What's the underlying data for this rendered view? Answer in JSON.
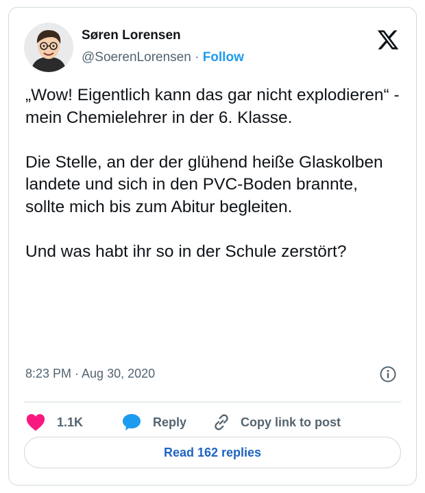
{
  "author": {
    "name": "Søren Lorensen",
    "handle": "@SoerenLorensen",
    "separator": "·",
    "follow_label": "Follow"
  },
  "tweet": {
    "text": "„Wow! Eigentlich kann das gar nicht explodieren“ - mein Chemielehrer in der 6. Klasse.\n\nDie Stelle, an der der glühend heiße Glaskolben landete und sich in den PVC-Boden brannte, sollte mich bis zum Abitur begleiten.\n\nUnd was habt ihr so in der Schule zerstört?",
    "timestamp": "8:23 PM · Aug 30, 2020"
  },
  "actions": {
    "likes": "1.1K",
    "reply_label": "Reply",
    "copy_label": "Copy link to post"
  },
  "read_replies_label": "Read 162 replies",
  "icons": {
    "logo": "x-logo-icon",
    "info": "info-icon",
    "like": "heart-icon",
    "reply": "speech-bubble-icon",
    "copy": "link-icon"
  },
  "colors": {
    "accent": "#1d9bf0",
    "like": "#f91880",
    "reply_icon": "#1d9bf0",
    "muted": "#536471",
    "border": "#cfd9de"
  }
}
